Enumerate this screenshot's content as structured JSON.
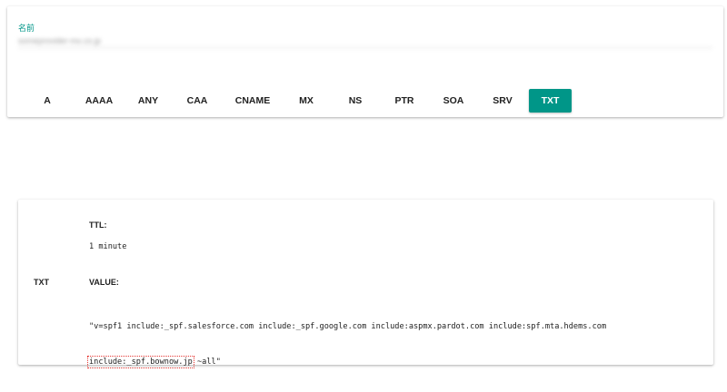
{
  "search": {
    "name_label": "名前",
    "name_value": "someprovider-mx.co.jp",
    "types": [
      "A",
      "AAAA",
      "ANY",
      "CAA",
      "CNAME",
      "MX",
      "NS",
      "PTR",
      "SOA",
      "SRV",
      "TXT"
    ],
    "selected_type": "TXT"
  },
  "result": {
    "record_type": "TXT",
    "ttl_label": "TTL:",
    "ttl_value": "1 minute",
    "value_label": "VALUE:",
    "value_line1": "\"v=spf1 include:_spf.salesforce.com include:_spf.google.com include:aspmx.pardot.com include:spf.mta.hdems.com",
    "value_highlight": "include:_spf.bownow.jp",
    "value_tail": " ~all\""
  },
  "colors": {
    "accent": "#009688",
    "highlight_border": "#e53935"
  }
}
